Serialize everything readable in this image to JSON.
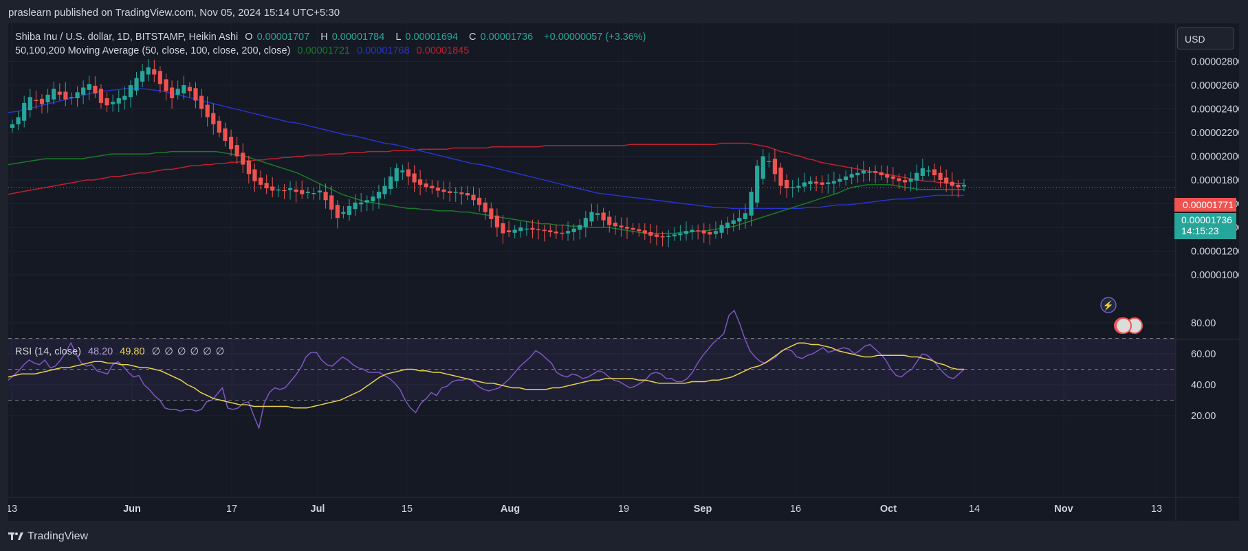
{
  "header": {
    "text": "praslearn published on TradingView.com, Nov 05, 2024 15:14 UTC+5:30"
  },
  "legend": {
    "symbol": "Shiba Inu / U.S. dollar, 1D, BITSTAMP, Heikin Ashi",
    "o_label": "O",
    "o": "0.00001707",
    "h_label": "H",
    "h": "0.00001784",
    "l_label": "L",
    "l": "0.00001694",
    "c_label": "C",
    "c": "0.00001736",
    "change": "+0.00000057 (+3.36%)",
    "ma_title": "50,100,200 Moving Average (50, close, 100, close, 200, close)",
    "ma50": "0.00001721",
    "ma100": "0.00001768",
    "ma200": "0.00001845",
    "rsi_title": "RSI (14, close)",
    "rsi": "48.20",
    "rsi_ma": "49.80",
    "rsi_empty": [
      "∅",
      "∅",
      "∅",
      "∅",
      "∅",
      "∅"
    ]
  },
  "currency": "USD",
  "price_labels": {
    "ma200_value": "0.00001771",
    "last_price": "0.00001736",
    "countdown": "14:15:23"
  },
  "colors": {
    "up": "#26a69a",
    "down": "#ef5350",
    "ma50": "#1b7a2a",
    "ma100": "#2934c8",
    "ma200": "#c0212e",
    "rsi": "#7e57c2",
    "rsi_ma": "#e8d44d",
    "bg": "#151924"
  },
  "footer": {
    "brand": "TradingView"
  },
  "chart_data": [
    {
      "type": "candlestick",
      "title": "Shiba Inu / U.S. dollar, 1D, BITSTAMP, Heikin Ashi",
      "ylim": [
        9e-07,
        3.1e-06
      ],
      "yticks": [
        "0.00001000",
        "0.00001200",
        "0.00001400",
        "0.00001600",
        "0.00001800",
        "0.00002000",
        "0.00002200",
        "0.00002400",
        "0.00002600",
        "0.00002800"
      ],
      "xticks": [
        "13",
        "Jun",
        "17",
        "Jul",
        "15",
        "Aug",
        "19",
        "Sep",
        "16",
        "Oct",
        "14",
        "Nov",
        "13"
      ],
      "current_price": 1.736e-05,
      "closes": [
        2.27,
        2.33,
        2.45,
        2.5,
        2.47,
        2.44,
        2.52,
        2.57,
        2.52,
        2.48,
        2.5,
        2.54,
        2.58,
        2.61,
        2.53,
        2.45,
        2.43,
        2.46,
        2.49,
        2.51,
        2.6,
        2.66,
        2.72,
        2.75,
        2.69,
        2.61,
        2.55,
        2.49,
        2.57,
        2.6,
        2.55,
        2.47,
        2.4,
        2.33,
        2.27,
        2.2,
        2.13,
        2.06,
        2.0,
        1.93,
        1.85,
        1.79,
        1.76,
        1.73,
        1.71,
        1.72,
        1.71,
        1.73,
        1.7,
        1.68,
        1.7,
        1.69,
        1.71,
        1.63,
        1.55,
        1.48,
        1.53,
        1.58,
        1.61,
        1.61,
        1.63,
        1.66,
        1.7,
        1.75,
        1.83,
        1.9,
        1.88,
        1.83,
        1.78,
        1.76,
        1.74,
        1.73,
        1.71,
        1.7,
        1.69,
        1.7,
        1.68,
        1.67,
        1.63,
        1.59,
        1.53,
        1.47,
        1.4,
        1.35,
        1.36,
        1.38,
        1.4,
        1.39,
        1.38,
        1.38,
        1.37,
        1.36,
        1.35,
        1.35,
        1.37,
        1.39,
        1.42,
        1.48,
        1.53,
        1.52,
        1.46,
        1.42,
        1.41,
        1.4,
        1.39,
        1.38,
        1.37,
        1.35,
        1.33,
        1.32,
        1.32,
        1.33,
        1.34,
        1.35,
        1.37,
        1.38,
        1.37,
        1.35,
        1.34,
        1.37,
        1.42,
        1.44,
        1.46,
        1.48,
        1.52,
        1.7,
        1.92,
        2.0,
        1.96,
        1.85,
        1.75,
        1.73,
        1.74,
        1.75,
        1.78,
        1.79,
        1.77,
        1.76,
        1.78,
        1.79,
        1.81,
        1.83,
        1.85,
        1.86,
        1.88,
        1.87,
        1.86,
        1.84,
        1.82,
        1.81,
        1.79,
        1.78,
        1.81,
        1.86,
        1.9,
        1.88,
        1.84,
        1.8,
        1.77,
        1.75,
        1.74,
        1.76
      ],
      "ma50": [
        1.93,
        1.94,
        1.95,
        1.96,
        1.97,
        1.98,
        1.98,
        1.98,
        1.98,
        1.98,
        1.98,
        1.99,
        2.0,
        2.01,
        2.02,
        2.02,
        2.02,
        2.02,
        2.02,
        2.02,
        2.03,
        2.03,
        2.04,
        2.04,
        2.04,
        2.04,
        2.04,
        2.04,
        2.04,
        2.03,
        2.02,
        2.01,
        2.0,
        1.98,
        1.96,
        1.94,
        1.92,
        1.9,
        1.88,
        1.86,
        1.83,
        1.8,
        1.77,
        1.74,
        1.71,
        1.68,
        1.66,
        1.64,
        1.62,
        1.61,
        1.6,
        1.59,
        1.58,
        1.57,
        1.56,
        1.56,
        1.55,
        1.55,
        1.54,
        1.54,
        1.54,
        1.53,
        1.53,
        1.52,
        1.51,
        1.5,
        1.49,
        1.48,
        1.47,
        1.46,
        1.45,
        1.44,
        1.43,
        1.43,
        1.42,
        1.42,
        1.41,
        1.41,
        1.4,
        1.4,
        1.4,
        1.4,
        1.39,
        1.38,
        1.37,
        1.36,
        1.35,
        1.35,
        1.35,
        1.35,
        1.35,
        1.36,
        1.36,
        1.37,
        1.37,
        1.38,
        1.39,
        1.4,
        1.41,
        1.43,
        1.45,
        1.47,
        1.49,
        1.51,
        1.53,
        1.55,
        1.57,
        1.59,
        1.61,
        1.63,
        1.65,
        1.67,
        1.69,
        1.72,
        1.74,
        1.75,
        1.76,
        1.76,
        1.76,
        1.76,
        1.75,
        1.74,
        1.73,
        1.72,
        1.72,
        1.72,
        1.72,
        1.72,
        1.72,
        1.72
      ],
      "ma100": [
        2.37,
        2.38,
        2.4,
        2.42,
        2.44,
        2.46,
        2.48,
        2.5,
        2.52,
        2.54,
        2.55,
        2.56,
        2.57,
        2.57,
        2.57,
        2.56,
        2.55,
        2.53,
        2.51,
        2.49,
        2.47,
        2.45,
        2.43,
        2.41,
        2.39,
        2.37,
        2.35,
        2.33,
        2.31,
        2.29,
        2.28,
        2.26,
        2.24,
        2.22,
        2.2,
        2.18,
        2.17,
        2.15,
        2.13,
        2.11,
        2.1,
        2.08,
        2.06,
        2.04,
        2.02,
        2.0,
        1.98,
        1.96,
        1.94,
        1.93,
        1.91,
        1.89,
        1.87,
        1.85,
        1.83,
        1.81,
        1.79,
        1.77,
        1.75,
        1.73,
        1.71,
        1.69,
        1.68,
        1.67,
        1.66,
        1.65,
        1.64,
        1.63,
        1.62,
        1.61,
        1.6,
        1.59,
        1.58,
        1.57,
        1.57,
        1.56,
        1.56,
        1.56,
        1.56,
        1.56,
        1.56,
        1.56,
        1.56,
        1.57,
        1.57,
        1.58,
        1.59,
        1.59,
        1.6,
        1.61,
        1.62,
        1.63,
        1.64,
        1.64,
        1.65,
        1.66,
        1.67,
        1.67,
        1.67,
        1.67
      ],
      "ma200": [
        1.68,
        1.69,
        1.7,
        1.71,
        1.72,
        1.73,
        1.74,
        1.75,
        1.76,
        1.77,
        1.78,
        1.79,
        1.8,
        1.8,
        1.81,
        1.82,
        1.83,
        1.83,
        1.84,
        1.85,
        1.86,
        1.86,
        1.87,
        1.88,
        1.89,
        1.89,
        1.9,
        1.91,
        1.92,
        1.92,
        1.93,
        1.93,
        1.94,
        1.94,
        1.95,
        1.95,
        1.96,
        1.96,
        1.97,
        1.97,
        1.98,
        1.98,
        1.99,
        1.99,
        2.0,
        2.0,
        2.01,
        2.01,
        2.01,
        2.02,
        2.02,
        2.02,
        2.03,
        2.03,
        2.03,
        2.04,
        2.04,
        2.04,
        2.04,
        2.05,
        2.05,
        2.05,
        2.05,
        2.06,
        2.06,
        2.06,
        2.06,
        2.06,
        2.07,
        2.07,
        2.07,
        2.07,
        2.07,
        2.07,
        2.08,
        2.08,
        2.08,
        2.08,
        2.08,
        2.08,
        2.08,
        2.08,
        2.09,
        2.09,
        2.09,
        2.09,
        2.09,
        2.09,
        2.09,
        2.09,
        2.09,
        2.09,
        2.09,
        2.09,
        2.09,
        2.1,
        2.1,
        2.1,
        2.1,
        2.1,
        2.1,
        2.1,
        2.1,
        2.1,
        2.1,
        2.1,
        2.1,
        2.1,
        2.1,
        2.11,
        2.11,
        2.11,
        2.11,
        2.11,
        2.1,
        2.09,
        2.08,
        2.06,
        2.04,
        2.03,
        2.01,
        2.0,
        1.98,
        1.97,
        1.95,
        1.94,
        1.93,
        1.92,
        1.91,
        1.9,
        1.89,
        1.88,
        1.87,
        1.86,
        1.85,
        1.84,
        1.83,
        1.82,
        1.81,
        1.8,
        1.79,
        1.79,
        1.78,
        1.78,
        1.77,
        1.77,
        1.77
      ],
      "value_scale": "1e-5"
    },
    {
      "type": "line",
      "title": "RSI (14, close)",
      "ylim": [
        10,
        90
      ],
      "yticks": [
        "20.00",
        "40.00",
        "60.00",
        "80.00"
      ],
      "bands": [
        30,
        50,
        70
      ],
      "rsi": [
        43,
        46,
        49,
        53,
        56,
        54,
        53,
        56,
        51,
        52,
        56,
        61,
        67,
        60,
        54,
        52,
        53,
        49,
        48,
        47,
        53,
        55,
        52,
        48,
        45,
        46,
        40,
        37,
        33,
        30,
        25,
        24,
        24,
        23,
        24,
        24,
        23,
        24,
        29,
        30,
        34,
        38,
        25,
        24,
        25,
        28,
        29,
        20,
        12,
        28,
        35,
        38,
        37,
        38,
        42,
        46,
        51,
        58,
        61,
        61,
        56,
        53,
        52,
        55,
        58,
        56,
        53,
        51,
        50,
        48,
        48,
        48,
        46,
        44,
        41,
        37,
        30,
        25,
        22,
        28,
        31,
        35,
        33,
        38,
        39,
        42,
        43,
        43,
        44,
        42,
        39,
        37,
        36,
        37,
        38,
        41,
        44,
        48,
        52,
        55,
        58,
        62,
        60,
        57,
        54,
        48,
        46,
        45,
        47,
        46,
        44,
        45,
        47,
        49,
        48,
        45,
        43,
        42,
        40,
        38,
        39,
        41,
        43,
        47,
        48,
        47,
        44,
        44,
        42,
        42,
        44,
        48,
        54,
        59,
        63,
        67,
        70,
        73,
        85,
        88,
        80,
        70,
        62,
        58,
        55,
        54,
        56,
        58,
        62,
        63,
        62,
        58,
        57,
        59,
        60,
        62,
        64,
        61,
        62,
        63,
        64,
        63,
        60,
        62,
        65,
        66,
        63,
        60,
        56,
        50,
        46,
        45,
        48,
        50,
        55,
        60,
        59,
        56,
        52,
        48,
        45,
        44,
        47,
        50
      ],
      "rsi_ma": [
        45,
        46,
        47,
        47,
        47,
        48,
        49,
        50,
        51,
        51,
        52,
        53,
        54,
        55,
        55,
        54,
        54,
        53,
        53,
        52,
        51,
        51,
        50,
        49,
        47,
        45,
        43,
        40,
        38,
        35,
        33,
        31,
        30,
        29,
        28,
        27,
        27,
        26,
        26,
        26,
        26,
        26,
        26,
        25,
        25,
        25,
        26,
        27,
        28,
        29,
        30,
        32,
        34,
        36,
        39,
        42,
        45,
        47,
        48,
        49,
        50,
        50,
        49,
        49,
        48,
        48,
        47,
        46,
        45,
        44,
        43,
        42,
        41,
        41,
        40,
        39,
        38,
        38,
        37,
        37,
        37,
        37,
        38,
        38,
        39,
        40,
        41,
        42,
        43,
        43,
        44,
        44,
        44,
        44,
        44,
        43,
        43,
        42,
        41,
        41,
        41,
        41,
        41,
        42,
        42,
        42,
        43,
        43,
        44,
        45,
        47,
        49,
        51,
        52,
        54,
        57,
        60,
        63,
        65,
        67,
        67,
        66,
        66,
        65,
        64,
        62,
        61,
        60,
        59,
        58,
        58,
        59,
        59,
        59,
        59,
        59,
        58,
        58,
        57,
        56,
        54,
        53,
        51,
        50,
        50
      ],
      "current": 48.2,
      "current_ma": 49.8
    }
  ]
}
